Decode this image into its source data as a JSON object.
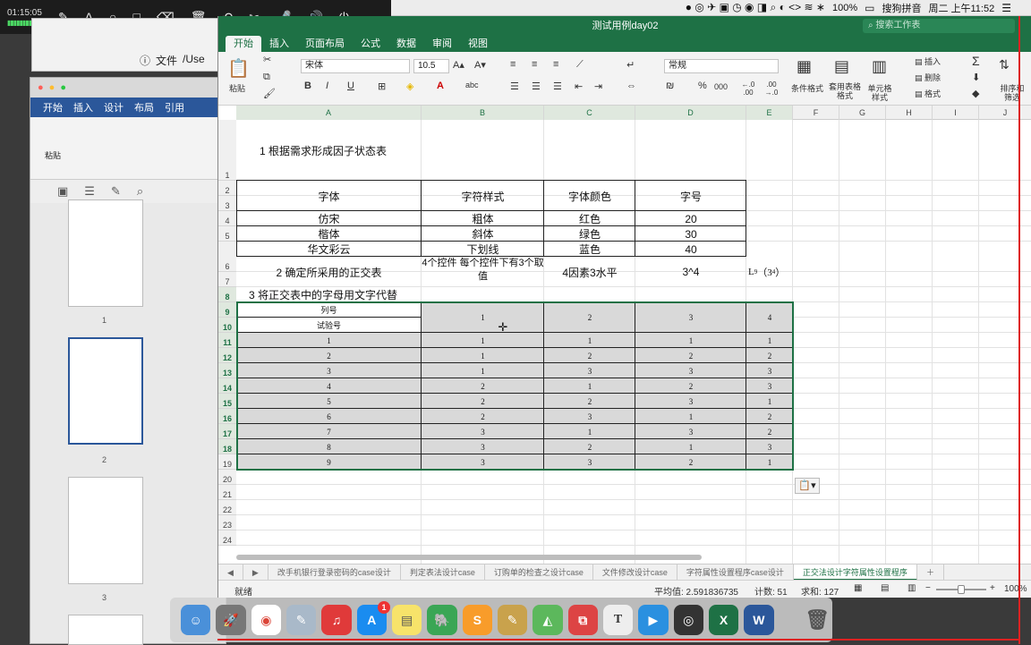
{
  "recorder": {
    "time": "01:15:05",
    "tools": [
      "✎",
      "A",
      "○",
      "□",
      "⌫",
      "🗑",
      "↶",
      "✂",
      "🎤",
      "🔊",
      "⏻"
    ]
  },
  "menubar": {
    "battery": "100%",
    "ime": "搜狗拼音",
    "clock": "周二 上午11:52"
  },
  "browser": {
    "file_label": "文件",
    "path": "/Use"
  },
  "word": {
    "tabs": [
      "开始",
      "插入",
      "设计",
      "布局",
      "引用"
    ],
    "paste_label": "粘贴",
    "thumb_numbers": [
      "1",
      "2",
      "3"
    ]
  },
  "excel": {
    "window_title": "测试用例day02",
    "search_placeholder": "搜索工作表",
    "tabs": [
      "开始",
      "插入",
      "页面布局",
      "公式",
      "数据",
      "审阅",
      "视图"
    ],
    "ribbon": {
      "paste": "粘贴",
      "font_name": "宋体",
      "font_size": "10.5",
      "number_format": "常规",
      "cond_format": "条件格式",
      "table_format": "套用表格格式",
      "cell_style": "单元格样式",
      "insert": "插入",
      "delete": "删除",
      "format": "格式",
      "sort_filter": "排序和筛选",
      "bold": "B",
      "italic": "I",
      "underline": "U",
      "percent": "%",
      "thousands": "000",
      "dec_inc": "←.0 .00",
      "dec_dec": ".00 →.0"
    },
    "columns": [
      "A",
      "B",
      "C",
      "D",
      "E",
      "F",
      "G",
      "H",
      "I",
      "J"
    ],
    "rows": [
      "1",
      "2",
      "3",
      "4",
      "5",
      "6",
      "7",
      "8",
      "9",
      "10",
      "11",
      "12",
      "13",
      "14",
      "15",
      "16",
      "17",
      "18",
      "19",
      "20",
      "21",
      "22",
      "23",
      "24"
    ],
    "sheet": {
      "title1": "1 根据需求形成因子状态表",
      "factor_headers": [
        "字体",
        "字符样式",
        "字体颜色",
        "字号"
      ],
      "factor_rows": [
        [
          "仿宋",
          "粗体",
          "红色",
          "20"
        ],
        [
          "楷体",
          "斜体",
          "绿色",
          "30"
        ],
        [
          "华文彩云",
          "下划线",
          "蓝色",
          "40"
        ]
      ],
      "row6": [
        "2 确定所采用的正交表",
        "4个控件 每个控件下有3个取值",
        "4因素3水平",
        "3^4"
      ],
      "l9_base": "L",
      "l9_sub": "9",
      "l9_paren": "（3",
      "l9_sup": "4",
      "l9_close": "）",
      "title3": "3 将正交表中的字母用文字代替",
      "col_label": "列号",
      "trial_label": "试验号",
      "col_numbers": [
        "1",
        "2",
        "3",
        "4"
      ],
      "orth_rows": [
        [
          "1",
          "1",
          "1",
          "1",
          "1"
        ],
        [
          "2",
          "1",
          "2",
          "2",
          "2"
        ],
        [
          "3",
          "1",
          "3",
          "3",
          "3"
        ],
        [
          "4",
          "2",
          "1",
          "2",
          "3"
        ],
        [
          "5",
          "2",
          "2",
          "3",
          "1"
        ],
        [
          "6",
          "2",
          "3",
          "1",
          "2"
        ],
        [
          "7",
          "3",
          "1",
          "3",
          "2"
        ],
        [
          "8",
          "3",
          "2",
          "1",
          "3"
        ],
        [
          "9",
          "3",
          "3",
          "2",
          "1"
        ]
      ]
    },
    "sheet_tabs": [
      "改手机银行登录密码的case设计",
      "判定表法设计case",
      "订购单的检查之设计case",
      "文件修改设计case",
      "字符属性设置程序case设计",
      "正交法设计字符属性设置程序"
    ],
    "status": {
      "mode": "就绪",
      "average": "平均值: 2.591836735",
      "count": "计数: 51",
      "sum": "求和: 127",
      "zoom": "100%"
    }
  },
  "dock": {
    "badge": "1",
    "text_icon": "T",
    "apps": [
      "finder-icon",
      "launchpad-icon",
      "chrome-icon",
      "preview-icon",
      "netease-music-icon",
      "app-store-icon",
      "notes-icon",
      "evernote-icon",
      "sublime-icon",
      "script-editor-icon",
      "maps-icon",
      "parallels-icon",
      "typora-icon",
      "tencent-video-icon",
      "obs-icon",
      "excel-icon",
      "word-icon",
      "trash-icon"
    ]
  }
}
